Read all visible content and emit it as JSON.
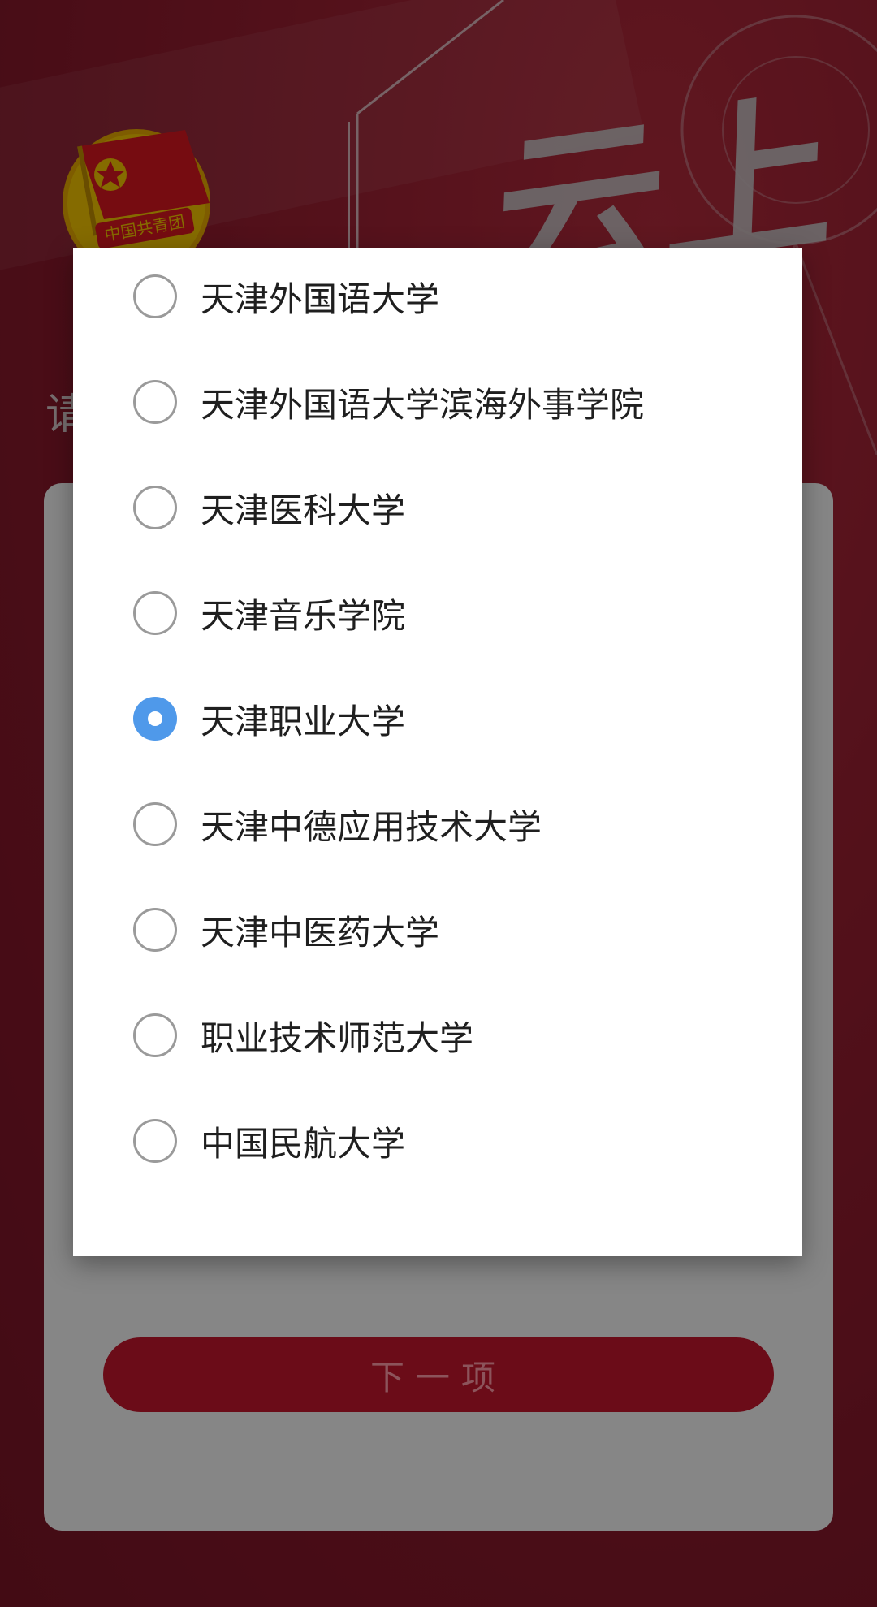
{
  "background": {
    "hero_text_line1": "云上",
    "hero_text_line2": "",
    "prompt_partial": "请",
    "next_button_label": "下一项",
    "emblem_text": "中国共青团"
  },
  "dialog": {
    "selected_index": 4,
    "options": [
      {
        "label": "天津外国语大学",
        "checked": false
      },
      {
        "label": "天津外国语大学滨海外事学院",
        "checked": false
      },
      {
        "label": "天津医科大学",
        "checked": false
      },
      {
        "label": "天津音乐学院",
        "checked": false
      },
      {
        "label": "天津职业大学",
        "checked": true
      },
      {
        "label": "天津中德应用技术大学",
        "checked": false
      },
      {
        "label": "天津中医药大学",
        "checked": false
      },
      {
        "label": "职业技术师范大学",
        "checked": false
      },
      {
        "label": "中国民航大学",
        "checked": false
      }
    ]
  },
  "colors": {
    "page_red": "#8f1c2b",
    "radio_selected": "#4f99ea",
    "radio_unselected_border": "#9a9a9a",
    "button_red": "#c3162d"
  }
}
